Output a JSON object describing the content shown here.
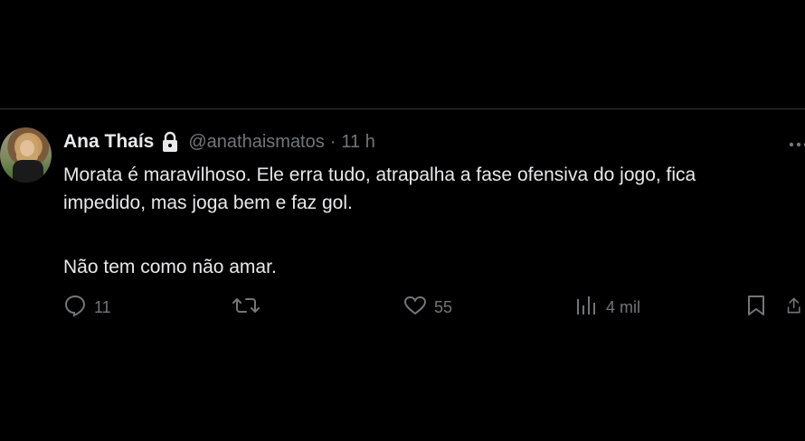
{
  "tweet": {
    "author_name": "Ana Thaís",
    "handle": "@anathaismatos",
    "separator": "·",
    "time": "11 h",
    "text_line1": "Morata é maravilhoso. Ele erra tudo, atrapalha a fase ofensiva do jogo, fica",
    "text_line2": "impedido, mas joga bem e faz gol.",
    "text_line3": "Não tem como não amar."
  },
  "actions": {
    "replies": "11",
    "retweets": "",
    "likes": "55",
    "views": "4 mil"
  },
  "icons": {
    "lock": "lock-icon",
    "more": "more-icon",
    "reply": "reply-icon",
    "retweet": "retweet-icon",
    "like": "heart-icon",
    "views": "views-icon",
    "bookmark": "bookmark-icon",
    "share": "share-icon"
  },
  "colors": {
    "background": "#000000",
    "text": "#e7e9ea",
    "secondary": "#71767b",
    "divider": "#2f3336"
  }
}
